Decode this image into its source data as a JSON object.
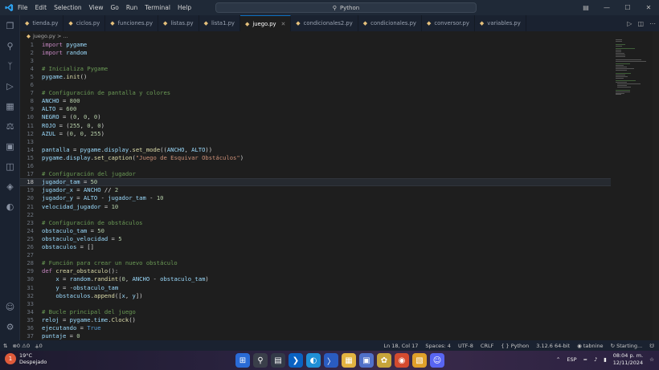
{
  "menu": [
    "File",
    "Edit",
    "Selection",
    "View",
    "Go",
    "Run",
    "Terminal",
    "Help"
  ],
  "search": {
    "label": "Python"
  },
  "tabs": [
    {
      "label": "tienda.py"
    },
    {
      "label": "ciclos.py"
    },
    {
      "label": "funciones.py"
    },
    {
      "label": "listas.py"
    },
    {
      "label": "lista1.py"
    },
    {
      "label": "juego.py",
      "active": true
    },
    {
      "label": "condicionales2.py"
    },
    {
      "label": "condicionales.py"
    },
    {
      "label": "conversor.py"
    },
    {
      "label": "variables.py"
    }
  ],
  "breadcrumb": "juego.py > ...",
  "current_line": 18,
  "code": [
    {
      "n": "1",
      "t": "import pygame"
    },
    {
      "n": "2",
      "t": "import random"
    },
    {
      "n": "3",
      "t": ""
    },
    {
      "n": "4",
      "t": "# Inicializa Pygame"
    },
    {
      "n": "5",
      "t": "pygame.init()"
    },
    {
      "n": "6",
      "t": ""
    },
    {
      "n": "7",
      "t": "# Configuración de pantalla y colores"
    },
    {
      "n": "8",
      "t": "ANCHO = 800"
    },
    {
      "n": "9",
      "t": "ALTO = 600"
    },
    {
      "n": "10",
      "t": "NEGRO = (0, 0, 0)"
    },
    {
      "n": "11",
      "t": "ROJO = (255, 0, 0)"
    },
    {
      "n": "12",
      "t": "AZUL = (0, 0, 255)"
    },
    {
      "n": "13",
      "t": ""
    },
    {
      "n": "14",
      "t": "pantalla = pygame.display.set_mode((ANCHO, ALTO))"
    },
    {
      "n": "15",
      "t": "pygame.display.set_caption(\"Juego de Esquivar Obstáculos\")"
    },
    {
      "n": "16",
      "t": ""
    },
    {
      "n": "17",
      "t": "# Configuración del jugador"
    },
    {
      "n": "18",
      "t": "jugador_tam = 50"
    },
    {
      "n": "19",
      "t": "jugador_x = ANCHO // 2"
    },
    {
      "n": "20",
      "t": "jugador_y = ALTO - jugador_tam - 10"
    },
    {
      "n": "21",
      "t": "velocidad_jugador = 10"
    },
    {
      "n": "22",
      "t": ""
    },
    {
      "n": "23",
      "t": "# Configuración de obstáculos"
    },
    {
      "n": "24",
      "t": "obstaculo_tam = 50"
    },
    {
      "n": "25",
      "t": "obstaculo_velocidad = 5"
    },
    {
      "n": "26",
      "t": "obstaculos = []"
    },
    {
      "n": "27",
      "t": ""
    },
    {
      "n": "28",
      "t": "# Función para crear un nuevo obstáculo"
    },
    {
      "n": "29",
      "t": "def crear_obstaculo():"
    },
    {
      "n": "30",
      "t": "    x = random.randint(0, ANCHO - obstaculo_tam)"
    },
    {
      "n": "31",
      "t": "    y = -obstaculo_tam"
    },
    {
      "n": "32",
      "t": "    obstaculos.append([x, y])"
    },
    {
      "n": "33",
      "t": ""
    },
    {
      "n": "34",
      "t": "# Bucle principal del juego"
    },
    {
      "n": "35",
      "t": "reloj = pygame.time.Clock()"
    },
    {
      "n": "36",
      "t": "ejecutando = True"
    },
    {
      "n": "37",
      "t": "puntaje = 0"
    }
  ],
  "status": {
    "errors": "0",
    "warnings": "0",
    "ports": "0",
    "position": "Ln 18, Col 17",
    "spaces": "Spaces: 4",
    "encoding": "UTF-8",
    "eol": "CRLF",
    "language": "Python",
    "interpreter": "3.12.6 64-bit",
    "tabnine": "tabnine",
    "starting": "Starting..."
  },
  "taskbar": {
    "temp": "19°C",
    "weather": "Despejado",
    "badge": "1",
    "lang": "ESP",
    "time": "08:04 p. m.",
    "date": "12/11/2024"
  }
}
